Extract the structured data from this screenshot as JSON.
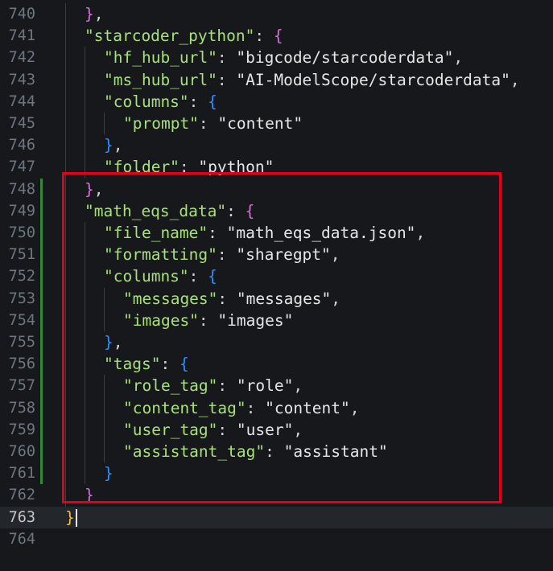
{
  "editor": {
    "lines": [
      {
        "num": "740",
        "indent": 1,
        "tokens": [
          [
            "b1",
            "}"
          ],
          [
            "p",
            ","
          ]
        ]
      },
      {
        "num": "741",
        "indent": 1,
        "tokens": [
          [
            "k",
            "\"starcoder_python\""
          ],
          [
            "p",
            ": "
          ],
          [
            "b1",
            "{"
          ]
        ]
      },
      {
        "num": "742",
        "indent": 2,
        "tokens": [
          [
            "k",
            "\"hf_hub_url\""
          ],
          [
            "p",
            ": "
          ],
          [
            "s",
            "\"bigcode/starcoderdata\""
          ],
          [
            "p",
            ","
          ]
        ]
      },
      {
        "num": "743",
        "indent": 2,
        "tokens": [
          [
            "k",
            "\"ms_hub_url\""
          ],
          [
            "p",
            ": "
          ],
          [
            "s",
            "\"AI-ModelScope/starcoderdata\""
          ],
          [
            "p",
            ","
          ]
        ]
      },
      {
        "num": "744",
        "indent": 2,
        "tokens": [
          [
            "k",
            "\"columns\""
          ],
          [
            "p",
            ": "
          ],
          [
            "b2",
            "{"
          ]
        ]
      },
      {
        "num": "745",
        "indent": 3,
        "tokens": [
          [
            "k",
            "\"prompt\""
          ],
          [
            "p",
            ": "
          ],
          [
            "s",
            "\"content\""
          ]
        ]
      },
      {
        "num": "746",
        "indent": 2,
        "tokens": [
          [
            "b2",
            "}"
          ],
          [
            "p",
            ","
          ]
        ]
      },
      {
        "num": "747",
        "indent": 2,
        "tokens": [
          [
            "k",
            "\"folder\""
          ],
          [
            "p",
            ": "
          ],
          [
            "s",
            "\"python\""
          ]
        ]
      },
      {
        "num": "748",
        "indent": 1,
        "tokens": [
          [
            "b1",
            "}"
          ],
          [
            "p",
            ","
          ]
        ],
        "modified": true
      },
      {
        "num": "749",
        "indent": 1,
        "tokens": [
          [
            "k",
            "\"math_eqs_data\""
          ],
          [
            "p",
            ": "
          ],
          [
            "b1",
            "{"
          ]
        ],
        "modified": true
      },
      {
        "num": "750",
        "indent": 2,
        "tokens": [
          [
            "k",
            "\"file_name\""
          ],
          [
            "p",
            ": "
          ],
          [
            "s",
            "\"math_eqs_data.json\""
          ],
          [
            "p",
            ","
          ]
        ],
        "modified": true
      },
      {
        "num": "751",
        "indent": 2,
        "tokens": [
          [
            "k",
            "\"formatting\""
          ],
          [
            "p",
            ": "
          ],
          [
            "s",
            "\"sharegpt\""
          ],
          [
            "p",
            ","
          ]
        ],
        "modified": true
      },
      {
        "num": "752",
        "indent": 2,
        "tokens": [
          [
            "k",
            "\"columns\""
          ],
          [
            "p",
            ": "
          ],
          [
            "b2",
            "{"
          ]
        ],
        "modified": true
      },
      {
        "num": "753",
        "indent": 3,
        "tokens": [
          [
            "k",
            "\"messages\""
          ],
          [
            "p",
            ": "
          ],
          [
            "s",
            "\"messages\""
          ],
          [
            "p",
            ","
          ]
        ],
        "modified": true
      },
      {
        "num": "754",
        "indent": 3,
        "tokens": [
          [
            "k",
            "\"images\""
          ],
          [
            "p",
            ": "
          ],
          [
            "s",
            "\"images\""
          ]
        ],
        "modified": true
      },
      {
        "num": "755",
        "indent": 2,
        "tokens": [
          [
            "b2",
            "}"
          ],
          [
            "p",
            ","
          ]
        ],
        "modified": true
      },
      {
        "num": "756",
        "indent": 2,
        "tokens": [
          [
            "k",
            "\"tags\""
          ],
          [
            "p",
            ": "
          ],
          [
            "b2",
            "{"
          ]
        ],
        "modified": true
      },
      {
        "num": "757",
        "indent": 3,
        "tokens": [
          [
            "k",
            "\"role_tag\""
          ],
          [
            "p",
            ": "
          ],
          [
            "s",
            "\"role\""
          ],
          [
            "p",
            ","
          ]
        ],
        "modified": true
      },
      {
        "num": "758",
        "indent": 3,
        "tokens": [
          [
            "k",
            "\"content_tag\""
          ],
          [
            "p",
            ": "
          ],
          [
            "s",
            "\"content\""
          ],
          [
            "p",
            ","
          ]
        ],
        "modified": true
      },
      {
        "num": "759",
        "indent": 3,
        "tokens": [
          [
            "k",
            "\"user_tag\""
          ],
          [
            "p",
            ": "
          ],
          [
            "s",
            "\"user\""
          ],
          [
            "p",
            ","
          ]
        ],
        "modified": true
      },
      {
        "num": "760",
        "indent": 3,
        "tokens": [
          [
            "k",
            "\"assistant_tag\""
          ],
          [
            "p",
            ": "
          ],
          [
            "s",
            "\"assistant\""
          ]
        ],
        "modified": true
      },
      {
        "num": "761",
        "indent": 2,
        "tokens": [
          [
            "b2",
            "}"
          ]
        ],
        "modified": true
      },
      {
        "num": "762",
        "indent": 1,
        "tokens": [
          [
            "b1",
            "}"
          ]
        ]
      },
      {
        "num": "763",
        "indent": 0,
        "tokens": [
          [
            "b0",
            "}"
          ]
        ],
        "current": true,
        "cursor": true
      },
      {
        "num": "764",
        "indent": 0,
        "tokens": []
      }
    ]
  },
  "colors": {
    "background": "#16181c",
    "key": "#a8e07a",
    "string": "#e6e6e6",
    "brace_level_1": "#d470d8",
    "brace_level_2": "#2f8fff",
    "brace_root": "#e8c33a",
    "highlight_box": "#e4001b",
    "modified_bar": "#2f8a3a"
  }
}
